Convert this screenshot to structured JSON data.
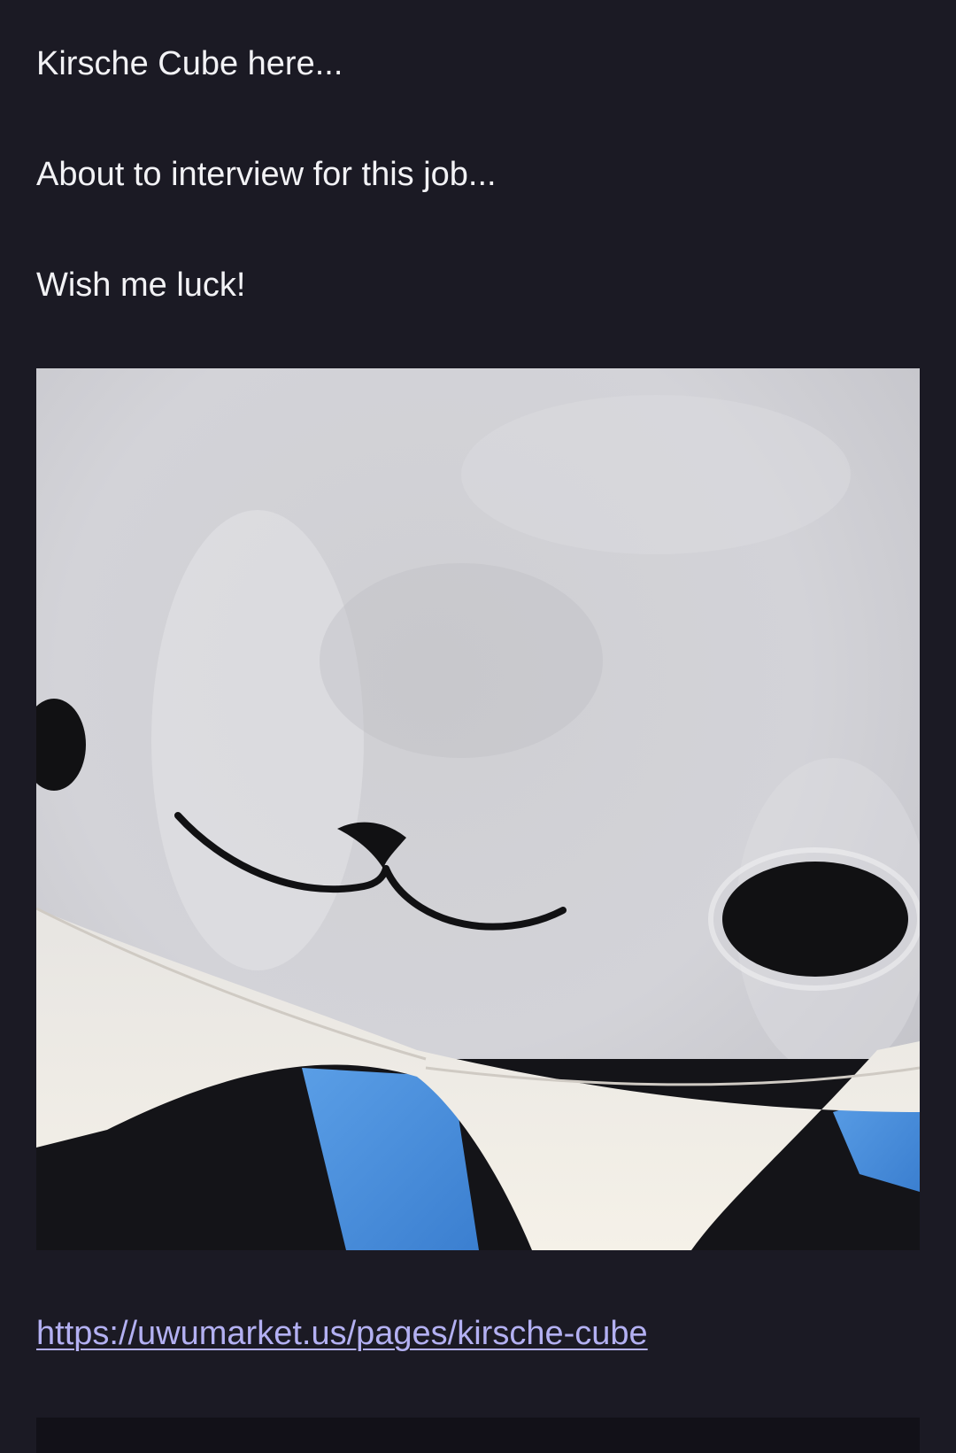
{
  "post": {
    "lines": [
      "Kirsche Cube here...",
      "About to interview for this job...",
      "Wish me luck!"
    ],
    "image_subject": "plush-toy-closeup",
    "link": {
      "text": "https://uwumarket.us/pages/kirsche-cube",
      "href": "https://uwumarket.us/pages/kirsche-cube"
    }
  },
  "colors": {
    "background": "#1b1a24",
    "text": "#f2f2f5",
    "link": "#b3b0f2"
  }
}
